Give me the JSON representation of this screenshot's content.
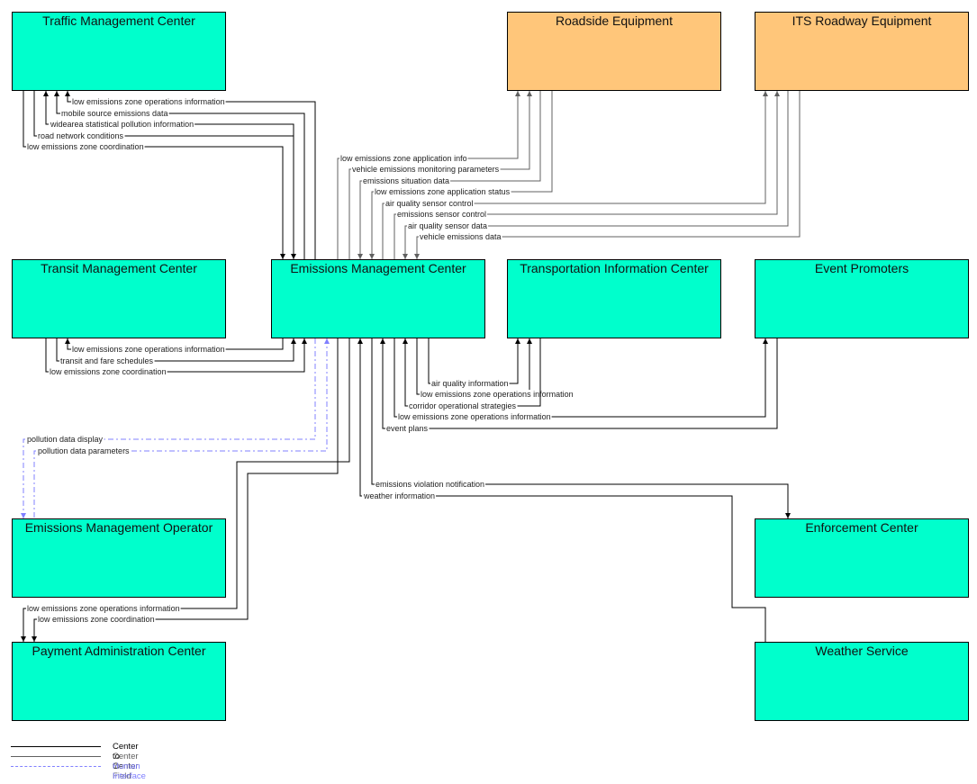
{
  "colors": {
    "center": "#00ffcc",
    "field": "#ffc67a",
    "center_to_center": "#000000",
    "center_to_field": "#606060",
    "human_interface": "#8080ff"
  },
  "nodes": [
    {
      "id": "tmc",
      "label": "Traffic Management Center",
      "kind": "center"
    },
    {
      "id": "rse",
      "label": "Roadside Equipment",
      "kind": "field"
    },
    {
      "id": "its",
      "label": "ITS Roadway Equipment",
      "kind": "field"
    },
    {
      "id": "trmc",
      "label": "Transit Management Center",
      "kind": "center"
    },
    {
      "id": "emc",
      "label": "Emissions Management Center",
      "kind": "center"
    },
    {
      "id": "tic",
      "label": "Transportation Information Center",
      "kind": "center"
    },
    {
      "id": "ep",
      "label": "Event Promoters",
      "kind": "center"
    },
    {
      "id": "emo",
      "label": "Emissions Management Operator",
      "kind": "center"
    },
    {
      "id": "enf",
      "label": "Enforcement Center",
      "kind": "center"
    },
    {
      "id": "pac",
      "label": "Payment Administration Center",
      "kind": "center"
    },
    {
      "id": "ws",
      "label": "Weather Service",
      "kind": "center"
    }
  ],
  "flows": [
    {
      "label": "low emissions zone operations information",
      "from": "emc",
      "to": "tmc",
      "type": "center_to_center"
    },
    {
      "label": "mobile source emissions data",
      "from": "emc",
      "to": "tmc",
      "type": "center_to_center"
    },
    {
      "label": "widearea statistical pollution information",
      "from": "emc",
      "to": "tmc",
      "type": "center_to_center"
    },
    {
      "label": "road network conditions",
      "from": "tmc",
      "to": "emc",
      "type": "center_to_center"
    },
    {
      "label": "low emissions zone coordination",
      "from": "tmc",
      "to": "emc",
      "type": "center_to_center"
    },
    {
      "label": "low emissions zone application info",
      "from": "emc",
      "to": "rse",
      "type": "center_to_field"
    },
    {
      "label": "vehicle emissions monitoring parameters",
      "from": "emc",
      "to": "rse",
      "type": "center_to_field"
    },
    {
      "label": "emissions situation data",
      "from": "rse",
      "to": "emc",
      "type": "center_to_field"
    },
    {
      "label": "low emissions zone application status",
      "from": "rse",
      "to": "emc",
      "type": "center_to_field"
    },
    {
      "label": "air quality sensor control",
      "from": "emc",
      "to": "its",
      "type": "center_to_field"
    },
    {
      "label": "emissions sensor control",
      "from": "emc",
      "to": "its",
      "type": "center_to_field"
    },
    {
      "label": "air quality sensor data",
      "from": "its",
      "to": "emc",
      "type": "center_to_field"
    },
    {
      "label": "vehicle emissions data",
      "from": "its",
      "to": "emc",
      "type": "center_to_field"
    },
    {
      "label": "low emissions zone operations information",
      "from": "emc",
      "to": "trmc",
      "type": "center_to_center"
    },
    {
      "label": "transit and fare schedules",
      "from": "trmc",
      "to": "emc",
      "type": "center_to_center"
    },
    {
      "label": "low emissions zone coordination",
      "from": "trmc",
      "to": "emc",
      "type": "center_to_center"
    },
    {
      "label": "air quality information",
      "from": "emc",
      "to": "tic",
      "type": "center_to_center"
    },
    {
      "label": "low emissions zone operations information",
      "from": "emc",
      "to": "tic",
      "type": "center_to_center"
    },
    {
      "label": "corridor operational strategies",
      "from": "tic",
      "to": "emc",
      "type": "center_to_center"
    },
    {
      "label": "low emissions zone operations information",
      "from": "emc",
      "to": "ep",
      "type": "center_to_center"
    },
    {
      "label": "event plans",
      "from": "ep",
      "to": "emc",
      "type": "center_to_center"
    },
    {
      "label": "pollution data display",
      "from": "emc",
      "to": "emo",
      "type": "human_interface"
    },
    {
      "label": "pollution data parameters",
      "from": "emo",
      "to": "emc",
      "type": "human_interface"
    },
    {
      "label": "emissions violation notification",
      "from": "emc",
      "to": "enf",
      "type": "center_to_center"
    },
    {
      "label": "weather information",
      "from": "ws",
      "to": "emc",
      "type": "center_to_center"
    },
    {
      "label": "low emissions zone operations information",
      "from": "emc",
      "to": "pac",
      "type": "center_to_center"
    },
    {
      "label": "low emissions zone coordination",
      "from": "emc",
      "to": "pac",
      "type": "center_to_center"
    }
  ],
  "legend": [
    {
      "label": "Center to Center",
      "type": "center_to_center"
    },
    {
      "label": "Center to Field",
      "type": "center_to_field"
    },
    {
      "label": "Human Interface",
      "type": "human_interface"
    }
  ]
}
